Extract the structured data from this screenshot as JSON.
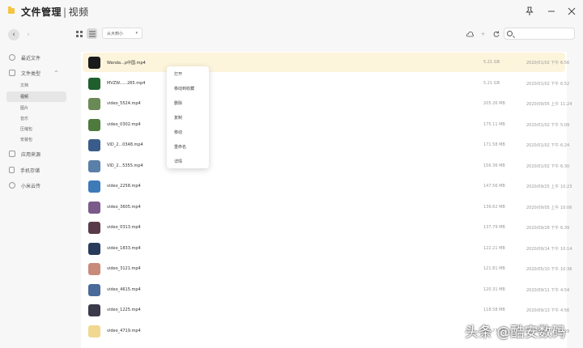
{
  "titlebar": {
    "title": "文件管理",
    "separator": "|",
    "subtitle": "视频"
  },
  "sidebar": {
    "items": [
      {
        "label": "最近文件",
        "icon": "clock-icon"
      },
      {
        "label": "文件类型",
        "icon": "folder-icon",
        "expanded": true
      },
      {
        "label": "应用来源",
        "icon": "apps-icon"
      },
      {
        "label": "手机存储",
        "icon": "phone-icon"
      },
      {
        "label": "小米云传",
        "icon": "cloud-icon"
      }
    ],
    "subitems": [
      {
        "label": "文档"
      },
      {
        "label": "视频",
        "active": true
      },
      {
        "label": "图片"
      },
      {
        "label": "音乐"
      },
      {
        "label": "压缩包"
      },
      {
        "label": "安装包"
      }
    ]
  },
  "toolbar": {
    "sort_label": "从大到小"
  },
  "files": [
    {
      "name": "Wanda...p中国.mp4",
      "size": "5.21 GB",
      "date": "2020/01/02 下午 6:56",
      "color": "#1a1a1a"
    },
    {
      "name": "MVZW......265.mp4",
      "size": "5.21 GB",
      "date": "2020/01/02 下午 6:52",
      "color": "#1f5f2d"
    },
    {
      "name": "video_5524.mp4",
      "size": "205.26 MB",
      "date": "2020/09/05 上午 11:24",
      "color": "#6a8a55"
    },
    {
      "name": "video_0302.mp4",
      "size": "175.11 MB",
      "date": "2020/01/02 下午 5:09",
      "color": "#4f7a3e"
    },
    {
      "name": "VID_2...0348.mp4",
      "size": "171.58 MB",
      "date": "2020/01/02 下午 6:24",
      "color": "#3a5c8a"
    },
    {
      "name": "VID_2...5355.mp4",
      "size": "156.36 MB",
      "date": "2020/01/02 下午 6:30",
      "color": "#5a7fa8"
    },
    {
      "name": "video_2258.mp4",
      "size": "147.56 MB",
      "date": "2020/09/25 上午 10:23",
      "color": "#3f7ab8"
    },
    {
      "name": "video_3605.mp4",
      "size": "139.62 MB",
      "date": "2020/09/05 上午 10:06",
      "color": "#7a5a8a"
    },
    {
      "name": "video_0313.mp4",
      "size": "137.79 MB",
      "date": "2020/09/28 下午 6:39",
      "color": "#5a3a4a"
    },
    {
      "name": "video_1833.mp4",
      "size": "122.21 MB",
      "date": "2020/09/14 下午 10:14",
      "color": "#2a3a5a"
    },
    {
      "name": "video_3121.mp4",
      "size": "121.81 MB",
      "date": "2020/05/10 下午 10:36",
      "color": "#c88a7a"
    },
    {
      "name": "video_4615.mp4",
      "size": "120.31 MB",
      "date": "2020/09/11 下午 4:54",
      "color": "#4a6a9a"
    },
    {
      "name": "video_1225.mp4",
      "size": "118.58 MB",
      "date": "2020/09/13 下午 4:56",
      "color": "#3a3a4a"
    },
    {
      "name": "video_4719.mp4",
      "size": "112.77 MB",
      "date": "2020/05/12 下午 8:29",
      "color": "#f0d890"
    }
  ],
  "context_menu": {
    "items": [
      "打开",
      "移动到收藏",
      "删除",
      "复制",
      "移动",
      "重命名",
      "详情"
    ]
  },
  "watermark": "头条 @酷安数码"
}
